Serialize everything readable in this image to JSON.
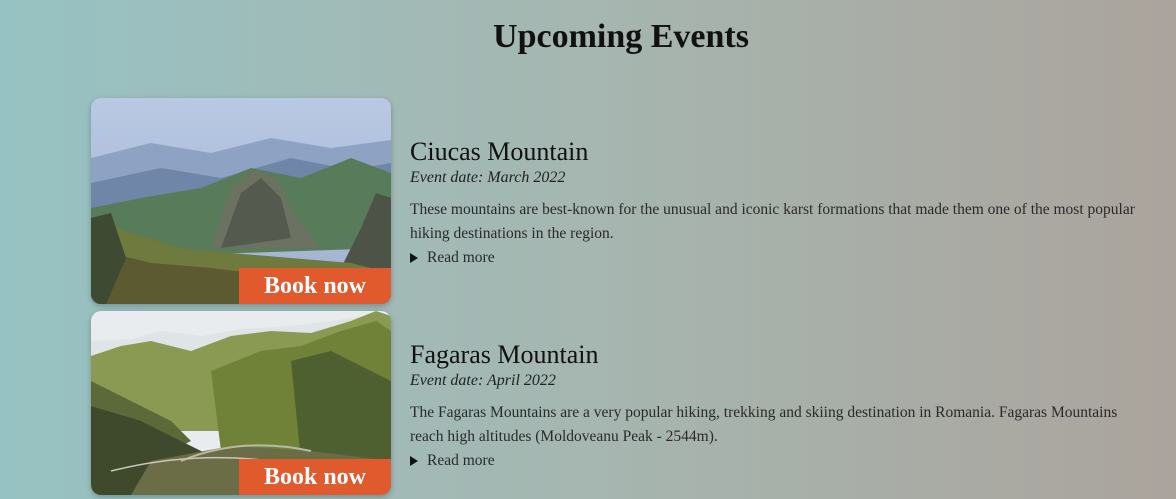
{
  "page": {
    "title": "Upcoming Events"
  },
  "events": [
    {
      "name": "Ciucas Mountain",
      "date": "Event date: March 2022",
      "description": "These mountains are best-known for the unusual and iconic karst formations that made them one of the most popular hiking destinations in the region.",
      "read_more": "Read more",
      "book_label": "Book now",
      "image_icon": "mountain-photo"
    },
    {
      "name": "Fagaras Mountain",
      "date": "Event date: April 2022",
      "description": "The Fagaras Mountains are a very popular hiking, trekking and skiing destination in Romania. Fagaras Mountains reach high altitudes (Moldoveanu Peak - 2544m).",
      "read_more": "Read more",
      "book_label": "Book now",
      "image_icon": "mountain-photo"
    }
  ],
  "colors": {
    "accent": "#e05a2e",
    "bg_left": "#97c2c3",
    "bg_right": "#aba49d"
  }
}
